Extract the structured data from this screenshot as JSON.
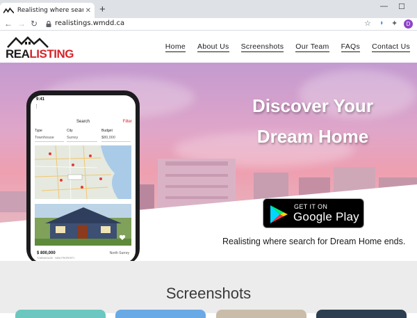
{
  "browser": {
    "tab_title": "Realisting where search for Drea",
    "url": "realistings.wmdd.ca",
    "profile_initial": "D"
  },
  "site": {
    "logo_part1": "REA",
    "logo_part2": "LISTING",
    "nav": [
      "Home",
      "About Us",
      "Screenshots",
      "Our Team",
      "FAQs",
      "Contact Us"
    ]
  },
  "hero": {
    "title": "Discover Your Dream Home",
    "store_small": "GET IT ON",
    "store_big": "Google Play",
    "tagline": "Realisting where search for Dream Home ends."
  },
  "phone": {
    "time": "9:41",
    "screen_title": "Search",
    "filter": "Filter",
    "filters": [
      {
        "label": "Type",
        "value": "Townhouse"
      },
      {
        "label": "City",
        "value": "Surrey"
      },
      {
        "label": "Budget",
        "value": "$80,000"
      }
    ],
    "price": "$ 800,000",
    "location": "North Surrey",
    "property_type": "TOWNHOUSE · NEW PROPERTY"
  },
  "screenshots": {
    "title": "Screenshots",
    "thumb_colors": [
      "#6cc7c0",
      "#69a9e6",
      "#c9bca9",
      "#2c3e50"
    ]
  },
  "colors": {
    "brand_red": "#d8232a",
    "brand_dark": "#1a1a1a"
  }
}
